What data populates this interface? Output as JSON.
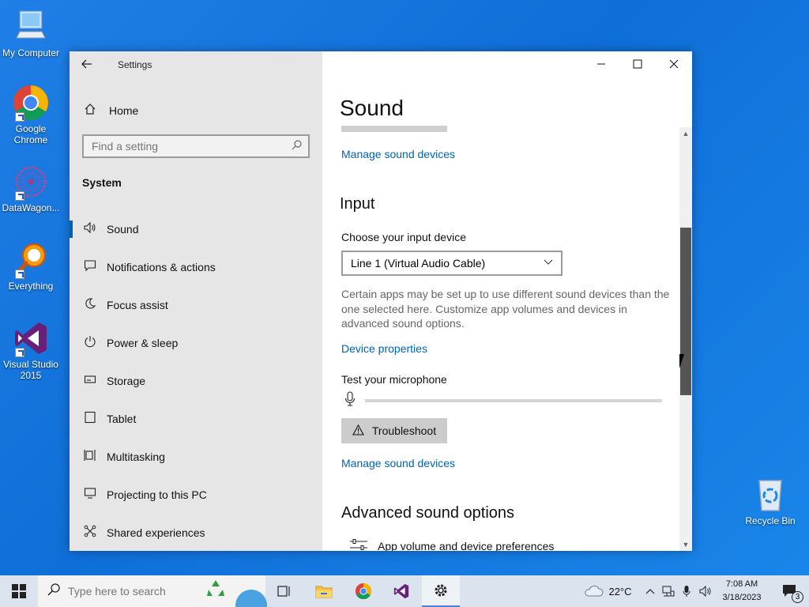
{
  "desktop": {
    "icons": [
      {
        "label": "My Computer"
      },
      {
        "label": "Google Chrome"
      },
      {
        "label": "DataWagon..."
      },
      {
        "label": "Everything"
      },
      {
        "label": "Visual Studio 2015"
      },
      {
        "label": "Recycle Bin"
      }
    ]
  },
  "window": {
    "app_title": "Settings",
    "back_icon": "arrow-left",
    "controls": {
      "minimize": "─",
      "maximize": "☐",
      "close": "✕"
    }
  },
  "sidebar": {
    "home_label": "Home",
    "search_placeholder": "Find a setting",
    "section": "System",
    "items": [
      {
        "label": "Sound",
        "icon": "speaker-icon",
        "glyph": "🔊",
        "active": true
      },
      {
        "label": "Notifications & actions",
        "icon": "notification-icon",
        "glyph": "▭"
      },
      {
        "label": "Focus assist",
        "icon": "moon-icon",
        "glyph": "☾"
      },
      {
        "label": "Power & sleep",
        "icon": "power-icon",
        "glyph": "⏻"
      },
      {
        "label": "Storage",
        "icon": "storage-icon",
        "glyph": "▭"
      },
      {
        "label": "Tablet",
        "icon": "tablet-icon",
        "glyph": "▯"
      },
      {
        "label": "Multitasking",
        "icon": "multitasking-icon",
        "glyph": "⊟"
      },
      {
        "label": "Projecting to this PC",
        "icon": "projector-icon",
        "glyph": "▭"
      },
      {
        "label": "Shared experiences",
        "icon": "share-icon",
        "glyph": "✕"
      }
    ]
  },
  "content": {
    "page_title": "Sound",
    "manage_link_1": "Manage sound devices",
    "input_heading": "Input",
    "choose_input_label": "Choose your input device",
    "input_device_value": "Line 1 (Virtual Audio Cable)",
    "description": "Certain apps may be set up to use different sound devices than the one selected here. Customize app volumes and devices in advanced sound options.",
    "device_properties_link": "Device properties",
    "test_mic_label": "Test your microphone",
    "mic_level": 0,
    "troubleshoot_label": "Troubleshoot",
    "manage_link_2": "Manage sound devices",
    "advanced_heading": "Advanced sound options",
    "app_volume_label": "App volume and device preferences"
  },
  "taskbar": {
    "search_placeholder": "Type here to search",
    "weather": "22°C",
    "time": "7:08 AM",
    "date": "3/18/2023",
    "notification_count": "3"
  }
}
